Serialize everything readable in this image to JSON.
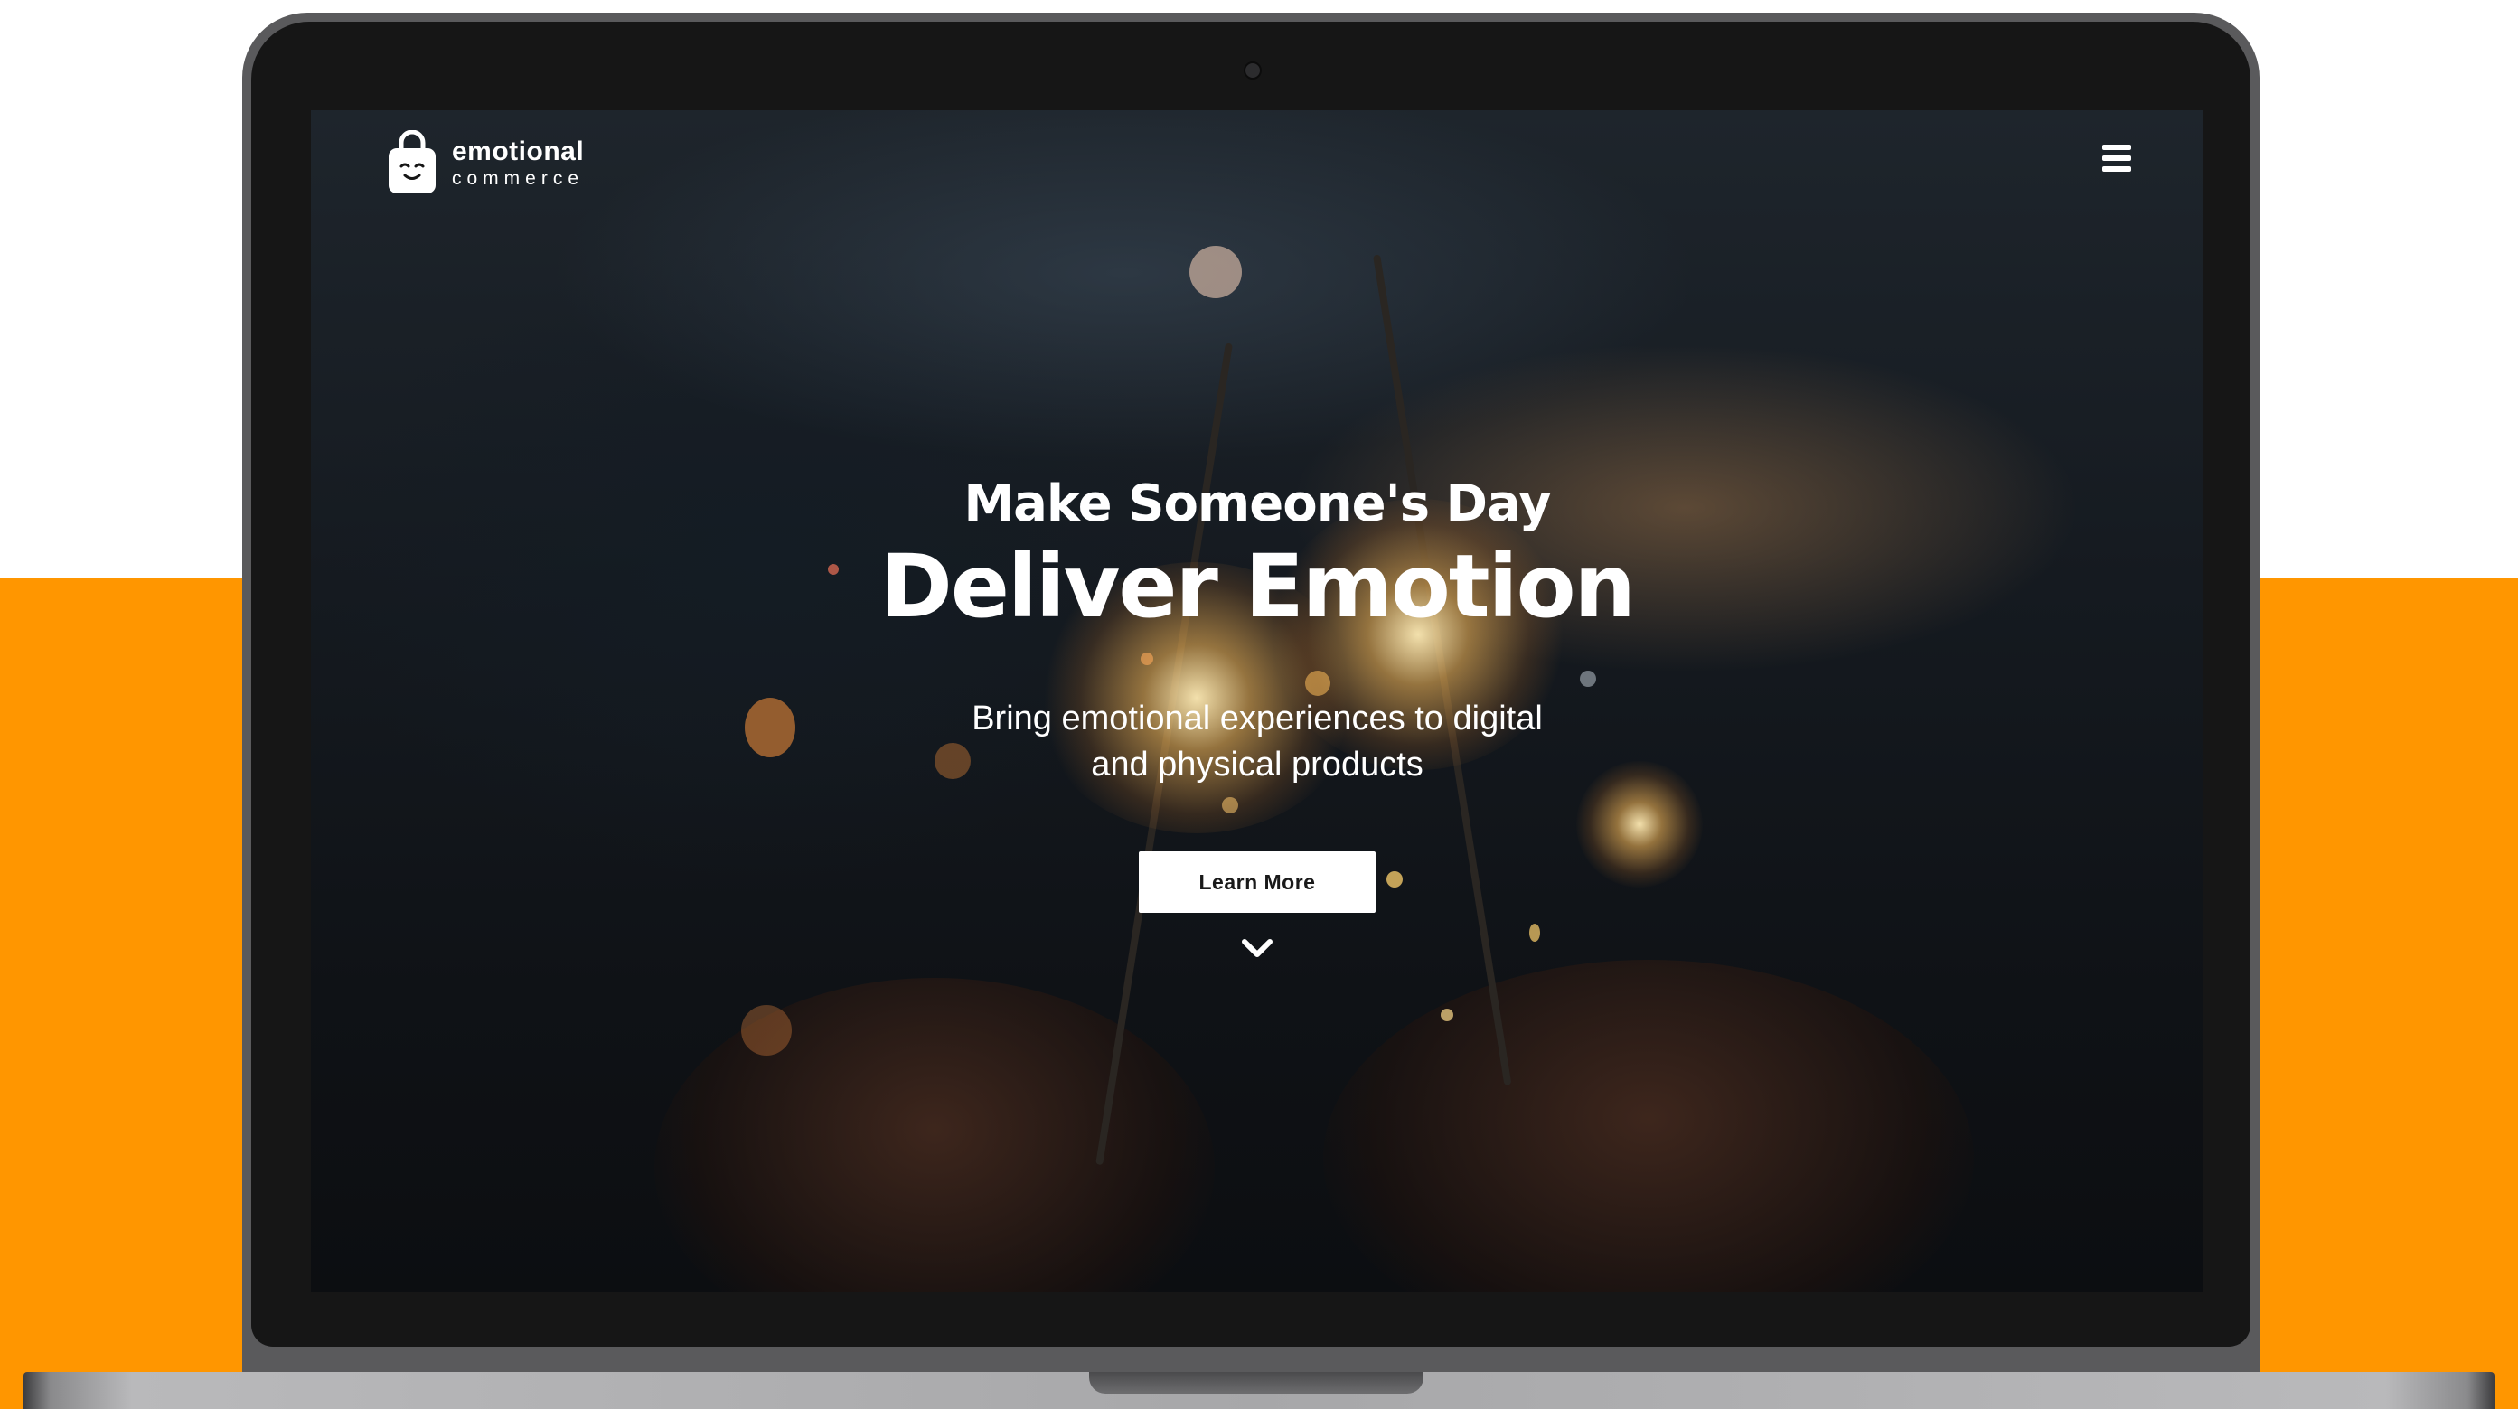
{
  "brand": {
    "name_line1": "emotional",
    "name_line2": "commerce",
    "logo_icon": "shopping-bag-smile-icon"
  },
  "nav": {
    "menu_icon": "hamburger-menu-icon"
  },
  "hero": {
    "kicker": "Make Someone's Day",
    "title": "Deliver Emotion",
    "subtitle_line1": "Bring emotional experiences to digital",
    "subtitle_line2": "and physical products",
    "cta_label": "Learn More",
    "scroll_icon": "chevron-down-icon"
  },
  "colors": {
    "accent_band": "#FF9600",
    "device_frame": "#5a5a5c",
    "bezel": "#161616",
    "text": "#ffffff",
    "button_bg": "#ffffff",
    "button_text": "#1a1a1a"
  }
}
